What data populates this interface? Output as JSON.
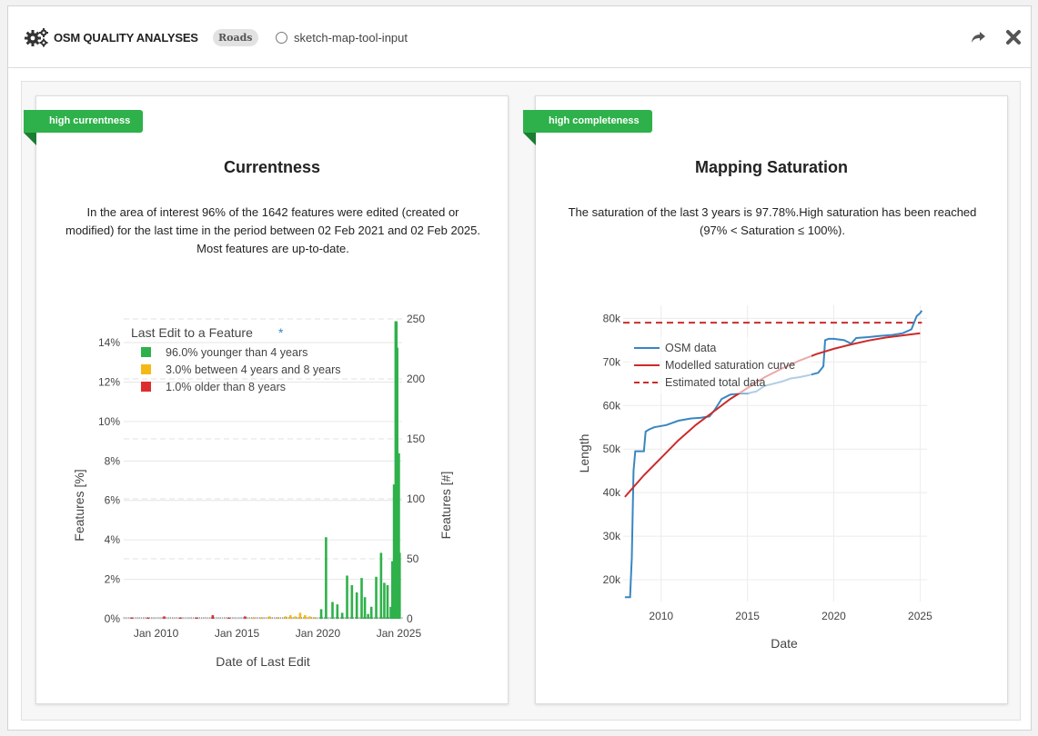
{
  "header": {
    "app_title": "OSM QUALITY ANALYSES",
    "topic_badge": "Roads",
    "aoi_label": "sketch-map-tool-input"
  },
  "cards": {
    "currentness": {
      "badge": "high currentness",
      "title": "Currentness",
      "description": "In the area of interest 96% of the 1642 features were edited (created or modified) for the last time in the period between 02 Feb 2021 and 02 Feb 2025. Most features are up-to-date."
    },
    "saturation": {
      "badge": "high completeness",
      "title": "Mapping Saturation",
      "description": "The saturation of the last 3 years is 97.78%.High saturation has been reached (97% < Saturation ≤ 100%)."
    }
  },
  "colors": {
    "badge_green": "#2eb14a",
    "younger": "#2eb14a",
    "between": "#f5b915",
    "older": "#dc2e2e",
    "osm_line": "#3a86c0",
    "model_line": "#cc2a2a"
  },
  "chart_data": [
    {
      "type": "bar",
      "legend_title": "Last Edit to a Feature",
      "legend_title_mark": "*",
      "legend": [
        {
          "label": "96.0% younger than 4 years",
          "color": "#2eb14a"
        },
        {
          "label": "3.0% between 4 years and 8 years",
          "color": "#f5b915"
        },
        {
          "label": "1.0% older than 8 years",
          "color": "#dc2e2e"
        }
      ],
      "xlabel": "Date of Last Edit",
      "ylabel_left": "Features [%]",
      "ylabel_right": "Features [#]",
      "x_ticks": [
        "Jan 2010",
        "Jan 2015",
        "Jan 2020",
        "Jan 2025"
      ],
      "y_left_ticks": [
        "0%",
        "2%",
        "4%",
        "6%",
        "8%",
        "10%",
        "12%",
        "14%"
      ],
      "y_right_ticks": [
        "0",
        "50",
        "100",
        "150",
        "200",
        "250"
      ],
      "ylim_left": [
        0,
        15.2
      ],
      "ylim_right": [
        0,
        250
      ],
      "xlim": [
        2008.0,
        2025.2
      ],
      "series": [
        {
          "name": "younger than 4 years",
          "color": "#2eb14a",
          "x": [
            2020.2,
            2020.5,
            2020.9,
            2021.2,
            2021.5,
            2021.8,
            2022.1,
            2022.4,
            2022.7,
            2022.9,
            2023.1,
            2023.3,
            2023.6,
            2023.9,
            2024.1,
            2024.3,
            2024.5,
            2024.6,
            2024.7,
            2024.75,
            2024.8,
            2024.85,
            2024.9,
            2024.95,
            2025.0,
            2025.05
          ],
          "values": [
            8,
            68,
            14,
            12,
            5,
            36,
            28,
            22,
            34,
            18,
            4,
            10,
            35,
            55,
            30,
            28,
            10,
            48,
            112,
            92,
            248,
            248,
            226,
            120,
            138,
            55
          ]
        },
        {
          "name": "between 4 years and 8 years",
          "color": "#f5b915",
          "x": [
            2016.0,
            2016.5,
            2017.0,
            2017.5,
            2018.0,
            2018.3,
            2018.6,
            2018.9,
            2019.2,
            2019.5,
            2019.8
          ],
          "values": [
            1,
            1,
            2,
            1,
            2,
            3,
            2,
            5,
            3,
            2,
            1
          ]
        },
        {
          "name": "older than 8 years",
          "color": "#dc2e2e",
          "x": [
            2008.5,
            2009.5,
            2010.5,
            2011.5,
            2012.5,
            2013.5,
            2014.5,
            2015.5
          ],
          "values": [
            1,
            1,
            2,
            1,
            1,
            3,
            1,
            2
          ]
        }
      ]
    },
    {
      "type": "line",
      "xlabel": "Date",
      "ylabel": "Length",
      "xlim": [
        2007.8,
        2025.4
      ],
      "ylim": [
        15000,
        83000
      ],
      "x_ticks": [
        "2010",
        "2015",
        "2020",
        "2025"
      ],
      "y_ticks": [
        "20k",
        "30k",
        "40k",
        "50k",
        "60k",
        "70k",
        "80k"
      ],
      "legend": [
        "OSM data",
        "Modelled saturation curve",
        "Estimated total data"
      ],
      "series": [
        {
          "name": "OSM data",
          "color": "#3a86c0",
          "x": [
            2007.9,
            2008.2,
            2008.3,
            2008.4,
            2008.5,
            2008.6,
            2009.0,
            2009.1,
            2009.3,
            2009.6,
            2010.3,
            2011.0,
            2011.7,
            2012.3,
            2012.8,
            2013.1,
            2013.5,
            2014.0,
            2014.6,
            2015.0,
            2015.5,
            2016.0,
            2016.5,
            2017.0,
            2017.5,
            2018.0,
            2018.6,
            2019.1,
            2019.4,
            2019.5,
            2019.7,
            2020.0,
            2020.6,
            2021.0,
            2021.3,
            2022.0,
            2022.7,
            2023.4,
            2024.0,
            2024.5,
            2024.8,
            2025.0,
            2025.1
          ],
          "y": [
            16000,
            16000,
            25000,
            45000,
            49500,
            49500,
            49500,
            54000,
            54500,
            55000,
            55500,
            56500,
            57000,
            57200,
            57500,
            59000,
            61500,
            62500,
            62800,
            62800,
            63200,
            64500,
            65000,
            65500,
            66200,
            66500,
            67000,
            67500,
            69000,
            75000,
            75300,
            75300,
            75000,
            74200,
            75500,
            75700,
            76000,
            76200,
            76600,
            77500,
            80500,
            81200,
            81800
          ]
        },
        {
          "name": "Modelled saturation curve",
          "color": "#cc2a2a",
          "x": [
            2007.9,
            2009.0,
            2010.0,
            2011.0,
            2012.0,
            2013.0,
            2014.0,
            2015.0,
            2016.0,
            2017.0,
            2018.0,
            2019.0,
            2020.0,
            2021.0,
            2022.0,
            2023.0,
            2024.0,
            2025.0
          ],
          "y": [
            39000,
            44000,
            48000,
            52000,
            55500,
            58500,
            61500,
            64000,
            66500,
            68500,
            70300,
            71800,
            73000,
            74000,
            74900,
            75600,
            76100,
            76600
          ]
        },
        {
          "name": "Estimated total data",
          "color": "#cc2a2a",
          "value": 79000
        }
      ]
    }
  ]
}
